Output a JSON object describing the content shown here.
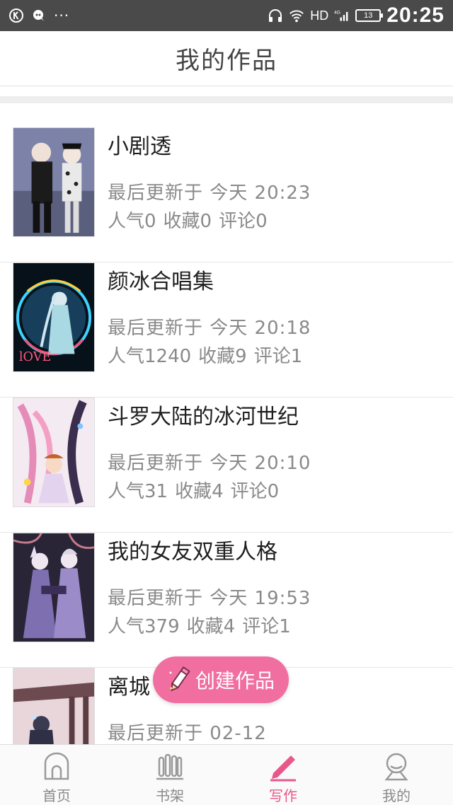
{
  "status_bar": {
    "network": "HD",
    "signal_label": "4G",
    "battery": "13",
    "time": "20:25"
  },
  "header": {
    "title": "我的作品"
  },
  "works": [
    {
      "title": "小剧透",
      "updated": "最后更新于 今天 20:23",
      "popularity": "人气0",
      "favorites": "收藏0",
      "comments": "评论0"
    },
    {
      "title": "颜冰合唱集",
      "updated": "最后更新于 今天 20:18",
      "popularity": "人气1240",
      "favorites": "收藏9",
      "comments": "评论1"
    },
    {
      "title": "斗罗大陆的冰河世纪",
      "updated": "最后更新于 今天 20:10",
      "popularity": "人气31",
      "favorites": "收藏4",
      "comments": "评论0"
    },
    {
      "title": "我的女友双重人格",
      "updated": "最后更新于 今天 19:53",
      "popularity": "人气379",
      "favorites": "收藏4",
      "comments": "评论1"
    },
    {
      "title": "离城",
      "updated": "最后更新于 02-12",
      "popularity": "",
      "favorites": "",
      "comments": ""
    }
  ],
  "create_button": {
    "label": "创建作品",
    "color": "#f06fa0"
  },
  "bottom_nav": {
    "items": [
      {
        "label": "首页",
        "icon": "home-icon"
      },
      {
        "label": "书架",
        "icon": "bookshelf-icon"
      },
      {
        "label": "写作",
        "icon": "write-pen-icon",
        "active": true
      },
      {
        "label": "我的",
        "icon": "profile-icon"
      }
    ],
    "active_color": "#e8578a"
  },
  "cover_palette": [
    "#6b6f8e",
    "#1a2f3a",
    "#d9c8e2",
    "#2a2340",
    "#e9d4d8"
  ]
}
